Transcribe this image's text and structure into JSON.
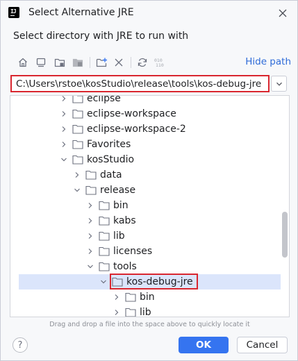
{
  "dialog": {
    "title": "Select Alternative JRE",
    "subtitle": "Select directory with JRE to run with",
    "close_icon": "close-icon"
  },
  "toolbar": {
    "buttons": [
      {
        "name": "home-icon"
      },
      {
        "name": "desktop-icon"
      },
      {
        "name": "project-folder-icon"
      },
      {
        "name": "module-folder-icon"
      },
      {
        "name": "new-folder-icon"
      },
      {
        "name": "delete-icon"
      },
      {
        "name": "refresh-icon"
      },
      {
        "name": "binary-icon"
      }
    ],
    "hide_path_label": "Hide path"
  },
  "path": {
    "value": "C:\\Users\\rstoe\\kosStudio\\release\\tools\\kos-debug-jre"
  },
  "tree": {
    "items": [
      {
        "label": "eclipse",
        "expanded": false
      },
      {
        "label": "eclipse-workspace",
        "expanded": false
      },
      {
        "label": "eclipse-workspace-2",
        "expanded": false
      },
      {
        "label": "Favorites",
        "expanded": false
      },
      {
        "label": "kosStudio",
        "expanded": true
      },
      {
        "label": "data",
        "expanded": false
      },
      {
        "label": "release",
        "expanded": true
      },
      {
        "label": "bin",
        "expanded": false
      },
      {
        "label": "kabs",
        "expanded": false
      },
      {
        "label": "lib",
        "expanded": false
      },
      {
        "label": "licenses",
        "expanded": false
      },
      {
        "label": "tools",
        "expanded": true
      },
      {
        "label": "kos-debug-jre",
        "expanded": true,
        "selected": true
      },
      {
        "label": "bin",
        "expanded": false
      },
      {
        "label": "lib",
        "expanded": false
      }
    ]
  },
  "hint": "Drag and drop a file into the space above to quickly locate it",
  "footer": {
    "help_label": "?",
    "ok_label": "OK",
    "cancel_label": "Cancel"
  },
  "colors": {
    "accent": "#3574f0",
    "link": "#2e6bd8",
    "highlight_border": "#d9262f",
    "selection": "#dbe5fb"
  }
}
